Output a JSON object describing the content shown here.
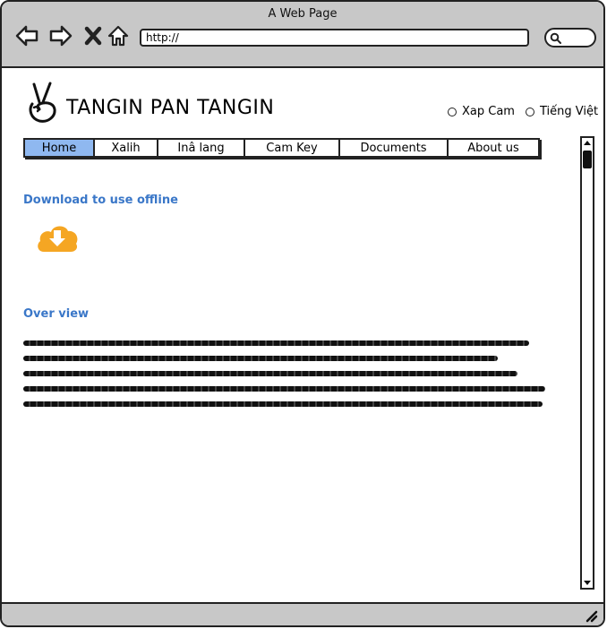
{
  "window": {
    "title": "A Web Page"
  },
  "browser": {
    "url": "http://",
    "icons": [
      "back-arrow-icon",
      "forward-arrow-icon",
      "close-x-icon",
      "home-icon",
      "search-icon"
    ]
  },
  "site": {
    "title": "TANGIN PAN TANGIN",
    "logo_icon": "peace-hand-icon"
  },
  "languages": [
    {
      "label": "Xap Cam"
    },
    {
      "label": "Tiếng Việt"
    }
  ],
  "tabs": [
    {
      "label": "Home",
      "active": true
    },
    {
      "label": "Xalih"
    },
    {
      "label": "Inâ lang"
    },
    {
      "label": "Cam Key"
    },
    {
      "label": "Documents"
    },
    {
      "label": "About us"
    }
  ],
  "download": {
    "heading": "Download to use offline",
    "icon": "cloud-download-icon"
  },
  "overview": {
    "heading": "Over view"
  },
  "colors": {
    "accent": "#3a77c8",
    "active_tab": "#8fb8f0",
    "download_icon": "#f5a623",
    "chrome": "#c8c8c8"
  }
}
